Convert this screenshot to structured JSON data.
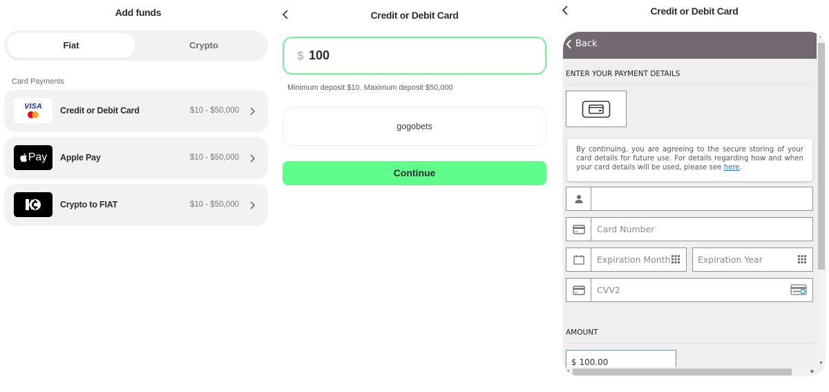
{
  "panel1": {
    "title": "Add funds",
    "tabs": [
      {
        "label": "Fiat",
        "active": true
      },
      {
        "label": "Crypto",
        "active": false
      }
    ],
    "section_label": "Card Payments",
    "methods": [
      {
        "name": "Credit or Debit Card",
        "range": "$10 - $50,000",
        "logo": "visa-mastercard-logo",
        "logo_text": "VISA"
      },
      {
        "name": "Apple Pay",
        "range": "$10 - $50,000",
        "logo": "apple-pay-logo",
        "logo_text": "Pay"
      },
      {
        "name": "Crypto to FIAT",
        "range": "$10 - $50,000",
        "logo": "crypto-to-fiat-logo",
        "logo_text": ""
      }
    ]
  },
  "panel2": {
    "title": "Credit or Debit Card",
    "amount": {
      "currency_symbol": "$",
      "value": "100"
    },
    "hint": "Minimum deposit $10. Maximum deposit $50,000",
    "merchant": "gogobets",
    "continue_label": "Continue"
  },
  "panel3": {
    "title": "Credit or Debit Card",
    "back_label": "Back",
    "heading": "ENTER YOUR PAYMENT DETAILS",
    "consent": {
      "text": "By continuing, you are agreeing to the secure storing of your card details for future use. For details regarding how and when your card details will be used, please see ",
      "link": "here",
      "suffix": "."
    },
    "fields": {
      "name_placeholder": "",
      "card_number_placeholder": "Card Number",
      "exp_month_placeholder": "Expiration Month",
      "exp_year_placeholder": "Expiration Year",
      "cvv_placeholder": "CVV2"
    },
    "amount_heading": "AMOUNT",
    "amount_value": "$ 100.00"
  },
  "colors": {
    "accent_green": "#5ffd89",
    "input_border_green": "#6cf28e",
    "frame_header": "#716870",
    "link_blue": "#1f6fd4"
  }
}
